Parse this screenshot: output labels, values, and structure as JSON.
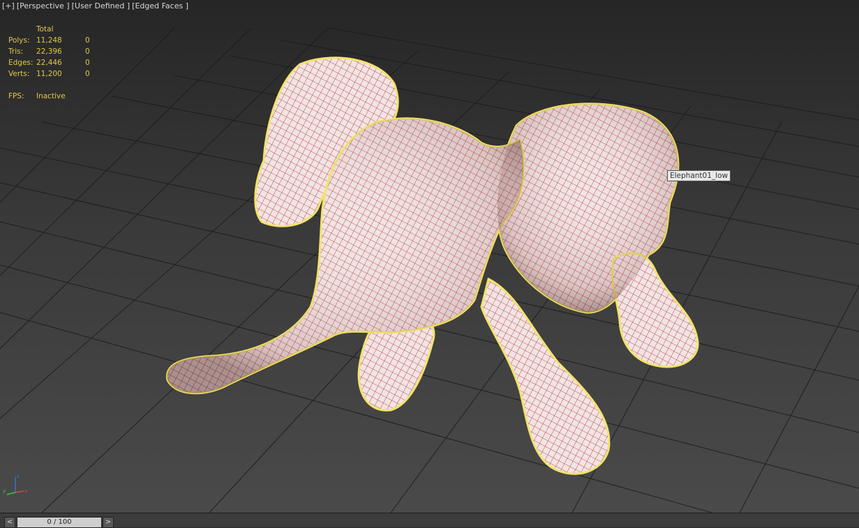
{
  "viewport": {
    "labels": [
      "[+]",
      "[Perspective ]",
      "[User Defined ]",
      "[Edged Faces ]"
    ]
  },
  "stats": {
    "header": "Total",
    "rows": [
      {
        "label": "Polys:",
        "total": "11,248",
        "selected": "0"
      },
      {
        "label": "Tris:",
        "total": "22,396",
        "selected": "0"
      },
      {
        "label": "Edges:",
        "total": "22,446",
        "selected": "0"
      },
      {
        "label": "Verts:",
        "total": "11,200",
        "selected": "0"
      }
    ],
    "fps_label": "FPS:",
    "fps_value": "Inactive"
  },
  "object_tooltip": "Elephant01_low",
  "axis": {
    "x": "x",
    "y": "y",
    "z": "z"
  },
  "timeline": {
    "prev": "<",
    "next": ">",
    "frame": "0 / 100"
  },
  "colors": {
    "selection_outline": "#f2e36a",
    "wire": "#b0211d",
    "surface": "#efe0e0",
    "stats_text": "#e0c84a"
  }
}
